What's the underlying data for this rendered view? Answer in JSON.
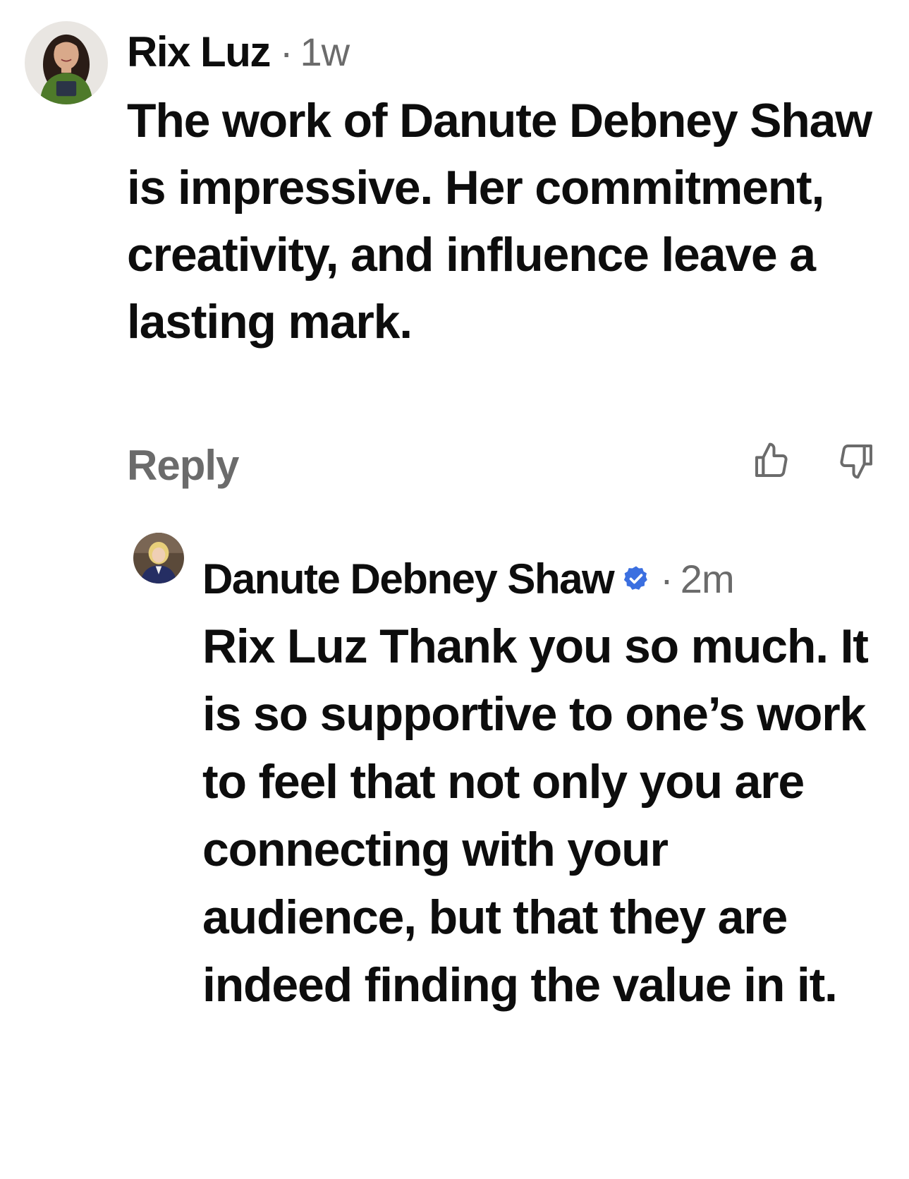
{
  "comments": [
    {
      "author": "Rix Luz",
      "separator": "·",
      "time": "1w",
      "text": "The work of Danute Debney Shaw is impressive. Her commitment, creativity, and influence leave a lasting mark.",
      "reply_label": "Reply",
      "icons": {
        "upvote": "thumbs-up-icon",
        "downvote": "thumbs-down-icon"
      }
    },
    {
      "author": "Danute Debney Shaw",
      "verified": true,
      "separator": "·",
      "time": "2m",
      "text": "Rix Luz Thank you so much.  It is so supportive to one’s work to feel that not only you are connecting with your audience, but that they are indeed finding the value in it.",
      "icons": {
        "verified": "verified-badge-icon"
      }
    }
  ],
  "colors": {
    "text": "#0d0d0d",
    "muted": "#6b6b6b",
    "verified": "#3b6fe0",
    "background": "#ffffff"
  }
}
